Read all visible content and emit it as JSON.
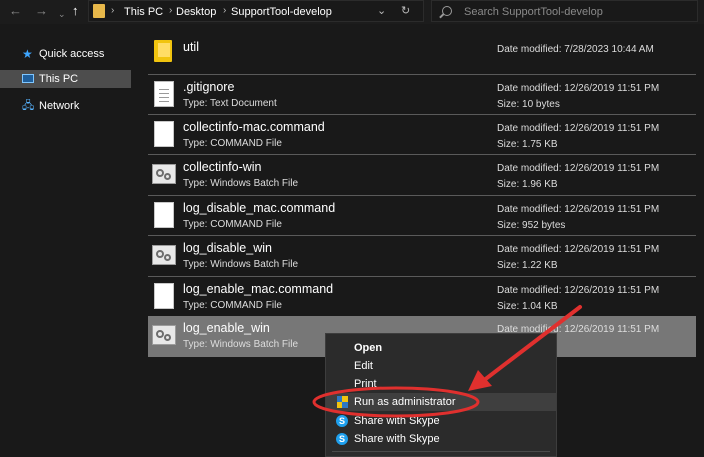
{
  "address": {
    "crumbs": [
      "This PC",
      "Desktop",
      "SupportTool-develop"
    ],
    "search_placeholder": "Search SupportTool-develop"
  },
  "sidebar": {
    "items": [
      {
        "label": "Quick access",
        "icon": "star-icon"
      },
      {
        "label": "This PC",
        "icon": "computer-icon",
        "selected": true
      },
      {
        "label": "Network",
        "icon": "network-icon"
      }
    ]
  },
  "files": [
    {
      "name": "util",
      "type": "",
      "modified": "Date modified: 7/28/2023 10:44 AM",
      "size": "",
      "icon": "folder-icon"
    },
    {
      "name": ".gitignore",
      "type": "Type: Text Document",
      "modified": "Date modified: 12/26/2019 11:51 PM",
      "size": "Size: 10 bytes",
      "icon": "text-document-icon"
    },
    {
      "name": "collectinfo-mac.command",
      "type": "Type: COMMAND File",
      "modified": "Date modified: 12/26/2019 11:51 PM",
      "size": "Size: 1.75 KB",
      "icon": "file-icon"
    },
    {
      "name": "collectinfo-win",
      "type": "Type: Windows Batch File",
      "modified": "Date modified: 12/26/2019 11:51 PM",
      "size": "Size: 1.96 KB",
      "icon": "batch-file-icon"
    },
    {
      "name": "log_disable_mac.command",
      "type": "Type: COMMAND File",
      "modified": "Date modified: 12/26/2019 11:51 PM",
      "size": "Size: 952 bytes",
      "icon": "file-icon"
    },
    {
      "name": "log_disable_win",
      "type": "Type: Windows Batch File",
      "modified": "Date modified: 12/26/2019 11:51 PM",
      "size": "Size: 1.22 KB",
      "icon": "batch-file-icon"
    },
    {
      "name": "log_enable_mac.command",
      "type": "Type: COMMAND File",
      "modified": "Date modified: 12/26/2019 11:51 PM",
      "size": "Size: 1.04 KB",
      "icon": "file-icon"
    },
    {
      "name": "log_enable_win",
      "type": "Type: Windows Batch File",
      "modified": "Date modified: 12/26/2019 11:51 PM",
      "size": "",
      "icon": "batch-file-icon",
      "selected": true
    }
  ],
  "context_menu": {
    "items": [
      {
        "label": "Open",
        "bold": true
      },
      {
        "label": "Edit"
      },
      {
        "label": "Print"
      },
      {
        "label": "Run as administrator",
        "icon": "uac-shield-icon"
      },
      {
        "label": "Share with Skype",
        "icon": "skype-icon"
      },
      {
        "label": "Share with Skype",
        "icon": "skype-icon"
      }
    ]
  },
  "colors": {
    "background": "#191919",
    "selected_row": "#777777",
    "annotation": "#e0302e"
  }
}
